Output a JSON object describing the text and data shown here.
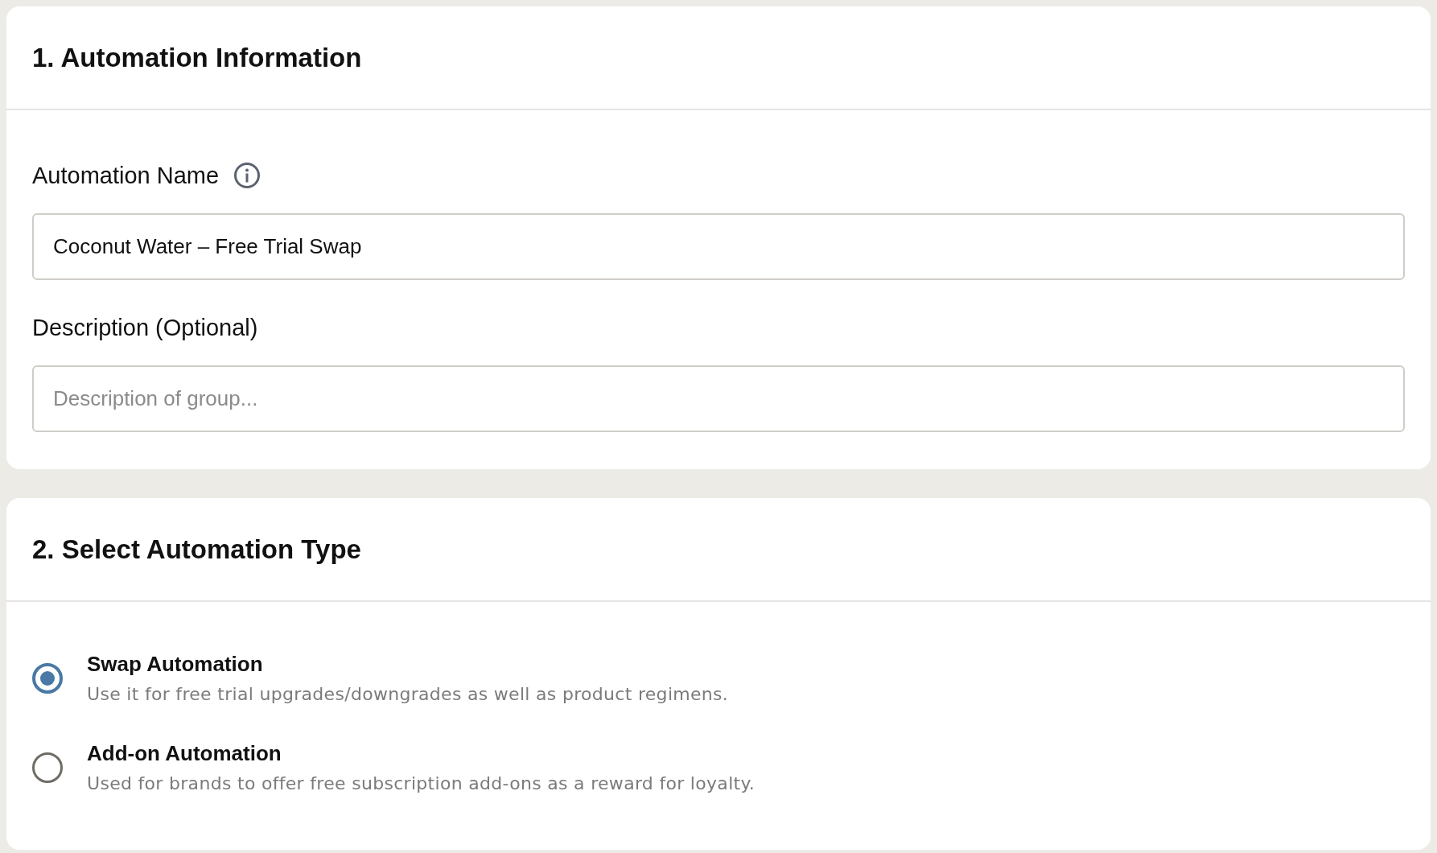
{
  "automation_information": {
    "title": "1. Automation Information",
    "fields": [
      {
        "label": "Automation Name",
        "info": true,
        "value": "Coconut Water – Free Trial Swap"
      },
      {
        "label": "Description (Optional)",
        "info": false,
        "placeholder": "Description of group..."
      }
    ]
  },
  "automation_type": {
    "title": "2. Select Automation Type",
    "options": [
      {
        "title": "Swap Automation",
        "description": "Use it for free trial upgrades/downgrades as well as product regimens.",
        "selected": true
      },
      {
        "title": "Add-on Automation",
        "description": "Used for brands to offer free subscription add-ons as a reward for loyalty.",
        "selected": false
      }
    ]
  }
}
